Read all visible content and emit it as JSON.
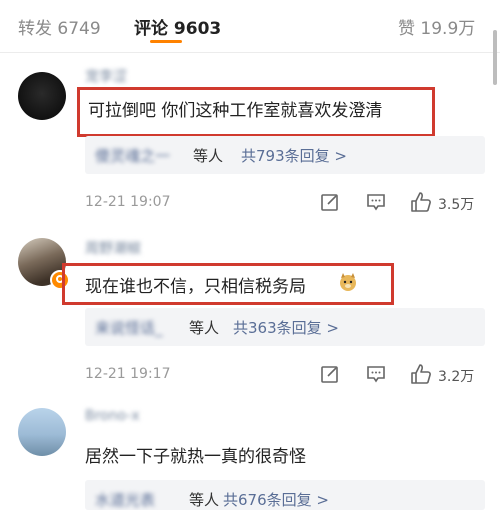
{
  "tabs": {
    "repost": "转发 6749",
    "comments": "评论 9603",
    "likes": "赞 19.9万"
  },
  "colors": {
    "accent": "#ff8200",
    "highlight": "#d03a2e",
    "link": "#5a6e96"
  },
  "comments": [
    {
      "username": "宠李涩",
      "text": "可拉倒吧 你们这种工作室就喜欢发澄清",
      "reply_name": "傻灵魂之一",
      "reply_deng": "等人",
      "reply_count": "共793条回复 >",
      "time": "12-21 19:07",
      "likes": "3.5万",
      "avatar_icon": "avatar-dark"
    },
    {
      "username": "周野潮椒",
      "text": "现在谁也不信，只相信税务局",
      "emoji": "doge-emoji",
      "reply_name": "来说怪话_",
      "reply_deng": "等人",
      "reply_count": "共363条回复 >",
      "time": "12-21 19:17",
      "likes": "3.2万",
      "avatar_icon": "avatar-photo"
    },
    {
      "username": "Brono-x",
      "text": "居然一下子就热一真的很奇怪",
      "reply_name": "水道光表",
      "reply_deng": "等人",
      "reply_count": "共676条回复 >",
      "avatar_icon": "avatar-sky"
    }
  ]
}
